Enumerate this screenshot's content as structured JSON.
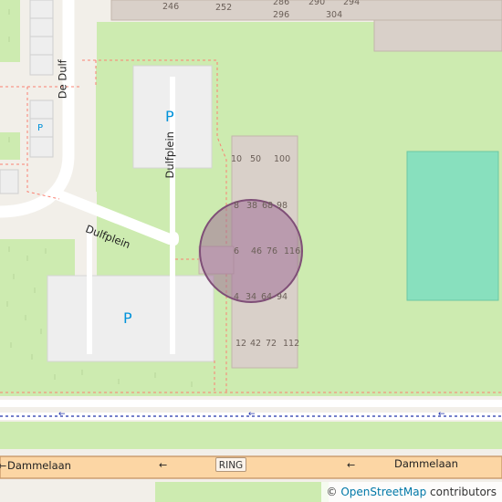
{
  "map": {
    "streets": {
      "de_dulf": "De Dulf",
      "dulfplein_1": "Dulfplein",
      "dulfplein_2": "Dulfplein",
      "dammelaan_1": "Dammelaan",
      "dammelaan_2": "Dammelaan"
    },
    "route_shield": "RING",
    "parking": {
      "large_1": "P",
      "large_2": "P",
      "small": "P"
    },
    "house_numbers": {
      "top": [
        "246",
        "252",
        "286",
        "296",
        "290",
        "294",
        "304"
      ],
      "block": [
        "10",
        "50",
        "100",
        "8",
        "38",
        "68",
        "98",
        "6",
        "46",
        "76",
        "116",
        "4",
        "34",
        "64",
        "94",
        "12",
        "42",
        "72",
        "112"
      ]
    },
    "oneway_arrow": "←",
    "attribution": {
      "copyright": "©",
      "link_text": "OpenStreetMap",
      "suffix": " contributors"
    },
    "colors": {
      "background": "#f2efe9",
      "grass": "#cdebb0",
      "building": "#d9d0c9",
      "pitch": "#88e0be",
      "parking": "#eeeeee",
      "road_major": "#fcd6a4",
      "marker": "#a07097"
    }
  }
}
